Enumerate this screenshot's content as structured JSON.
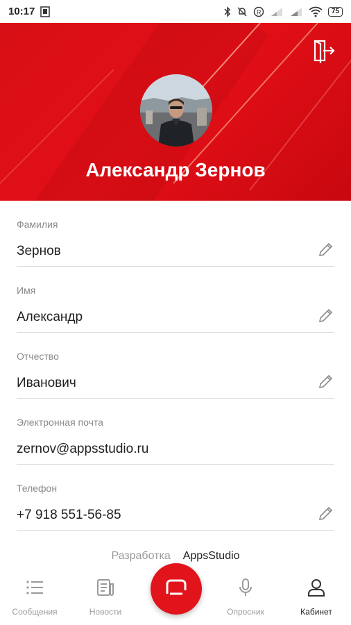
{
  "status_bar": {
    "time": "10:17",
    "battery": "75"
  },
  "header": {
    "name": "Александр Зернов",
    "accent_color": "#e30f17"
  },
  "fields": [
    {
      "label": "Фамилия",
      "value": "Зернов",
      "editable": true
    },
    {
      "label": "Имя",
      "value": "Александр",
      "editable": true
    },
    {
      "label": "Отчество",
      "value": "Иванович",
      "editable": true
    },
    {
      "label": "Электронная почта",
      "value": "zernov@appsstudio.ru",
      "editable": false
    },
    {
      "label": "Телефон",
      "value": "+7 918 551-56-85",
      "editable": true
    }
  ],
  "credits": {
    "prefix": "Разработка",
    "company": "AppsStudio"
  },
  "nav": {
    "items": [
      {
        "label": "Сообщения",
        "icon": "list-icon"
      },
      {
        "label": "Новости",
        "icon": "news-icon"
      },
      {
        "label": "Опросник",
        "icon": "microphone-icon"
      },
      {
        "label": "Кабинет",
        "icon": "user-icon",
        "active": true
      }
    ],
    "center_icon": "chat-icon"
  }
}
